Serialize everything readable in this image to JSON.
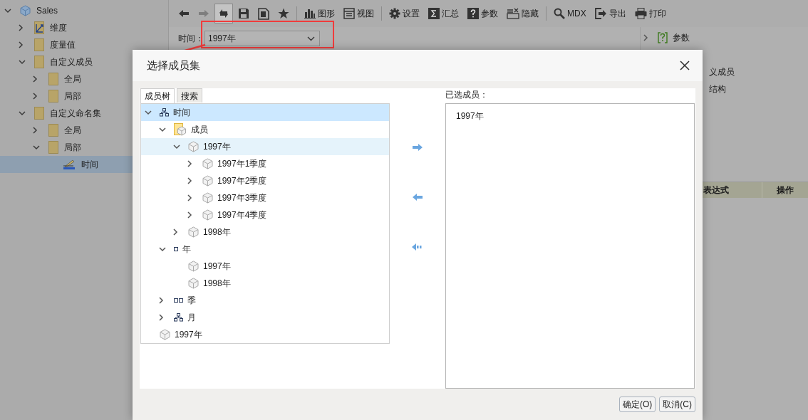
{
  "sidebar": {
    "tree": [
      {
        "label": "Sales",
        "kind": "cube",
        "expanded": true,
        "selected": false,
        "children": [
          {
            "label": "维度",
            "kind": "dimension",
            "expanded": false,
            "selected": false
          },
          {
            "label": "度量值",
            "kind": "folder",
            "expanded": false,
            "selected": false
          },
          {
            "label": "自定义成员",
            "kind": "folder",
            "expanded": true,
            "selected": false,
            "children": [
              {
                "label": "全局",
                "kind": "folder",
                "expanded": false,
                "selected": false
              },
              {
                "label": "局部",
                "kind": "folder",
                "expanded": false,
                "selected": false
              }
            ]
          },
          {
            "label": "自定义命名集",
            "kind": "folder",
            "expanded": true,
            "selected": false,
            "children": [
              {
                "label": "全局",
                "kind": "folder",
                "expanded": false,
                "selected": false
              },
              {
                "label": "局部",
                "kind": "folder",
                "expanded": true,
                "selected": false,
                "children": [
                  {
                    "label": "时间",
                    "kind": "edit",
                    "selected": true
                  }
                ]
              }
            ]
          }
        ]
      }
    ]
  },
  "toolbar": {
    "groups": [
      [
        {
          "kind": "back",
          "disabled": false,
          "pressed": false
        },
        {
          "kind": "forward",
          "disabled": true,
          "pressed": false
        },
        {
          "kind": "refresh",
          "disabled": false,
          "pressed": true
        },
        {
          "kind": "save",
          "disabled": false,
          "pressed": false
        },
        {
          "kind": "save-as",
          "disabled": false,
          "pressed": false
        },
        {
          "kind": "star",
          "disabled": false,
          "pressed": false
        }
      ],
      [
        {
          "kind": "chart",
          "label": "图形",
          "disabled": false,
          "pressed": false
        },
        {
          "kind": "view",
          "label": "视图",
          "disabled": false,
          "pressed": false
        }
      ],
      [
        {
          "kind": "gear",
          "label": "设置",
          "disabled": false,
          "pressed": false
        },
        {
          "kind": "sigma",
          "label": "汇总",
          "disabled": false,
          "pressed": false
        },
        {
          "kind": "question",
          "label": "参数",
          "disabled": false,
          "pressed": false
        },
        {
          "kind": "hide",
          "label": "隐藏",
          "disabled": false,
          "pressed": false
        }
      ],
      [
        {
          "kind": "search",
          "label": "MDX",
          "disabled": false,
          "pressed": false
        },
        {
          "kind": "export",
          "label": "导出",
          "disabled": false,
          "pressed": false
        },
        {
          "kind": "print",
          "label": "打印",
          "disabled": false,
          "pressed": false
        }
      ]
    ]
  },
  "parameter": {
    "label": "时间：",
    "value": "1997年"
  },
  "right_panel": {
    "items": [
      {
        "label": "参数",
        "expanded": false
      }
    ],
    "partial_items": [
      "义成员",
      "结构"
    ]
  },
  "table": {
    "columns": [
      "表达式",
      "操作"
    ]
  },
  "dialog": {
    "title": "选择成员集",
    "tabs": [
      {
        "label": "成员树",
        "selected": true
      },
      {
        "label": "搜索",
        "selected": false
      }
    ],
    "tree": [
      {
        "label": "时间",
        "kind": "hierarchy",
        "expanded": true,
        "selected": true,
        "hovered": false,
        "children": [
          {
            "label": "成员",
            "kind": "folder-cube",
            "expanded": true,
            "selected": false,
            "hovered": false,
            "children": [
              {
                "label": "1997年",
                "kind": "cube",
                "expanded": true,
                "selected": false,
                "hovered": true,
                "children": [
                  {
                    "label": "1997年1季度",
                    "kind": "cube",
                    "expanded": false,
                    "selected": false,
                    "hovered": false
                  },
                  {
                    "label": "1997年2季度",
                    "kind": "cube",
                    "expanded": false,
                    "selected": false,
                    "hovered": false
                  },
                  {
                    "label": "1997年3季度",
                    "kind": "cube",
                    "expanded": false,
                    "selected": false,
                    "hovered": false
                  },
                  {
                    "label": "1997年4季度",
                    "kind": "cube",
                    "expanded": false,
                    "selected": false,
                    "hovered": false
                  }
                ]
              },
              {
                "label": "1998年",
                "kind": "cube",
                "expanded": false,
                "selected": false,
                "hovered": false
              }
            ]
          },
          {
            "label": "年",
            "kind": "level-one",
            "expanded": true,
            "selected": false,
            "hovered": false,
            "children": [
              {
                "label": "1997年",
                "kind": "cube",
                "selected": false,
                "hovered": false
              },
              {
                "label": "1998年",
                "kind": "cube",
                "selected": false,
                "hovered": false
              }
            ]
          },
          {
            "label": "季",
            "kind": "level-two",
            "expanded": false,
            "selected": false,
            "hovered": false
          },
          {
            "label": "月",
            "kind": "hierarchy",
            "expanded": false,
            "selected": false,
            "hovered": false
          }
        ]
      },
      {
        "label": "1997年",
        "kind": "cube",
        "selected": false,
        "hovered": false
      }
    ],
    "transfer_buttons": [
      {
        "kind": "add"
      },
      {
        "kind": "remove"
      },
      {
        "kind": "remove-all"
      }
    ],
    "selected_label": "已选成员：",
    "selected_members": [
      "1997年"
    ],
    "buttons": [
      "确定(O)",
      "取消(C)"
    ]
  }
}
